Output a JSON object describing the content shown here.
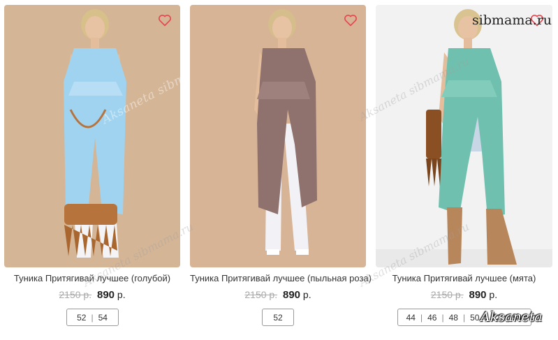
{
  "products": [
    {
      "title": "Туника Притягивай лучшее (голубой)",
      "old_price": "2150 р.",
      "new_price": "890",
      "currency": "р.",
      "sizes": [
        "52",
        "54"
      ],
      "bg_color": "#d4b596",
      "garment_color": "#9fd3ef"
    },
    {
      "title": "Туника Притягивай лучшее (пыльная роза)",
      "old_price": "2150 р.",
      "new_price": "890",
      "currency": "р.",
      "sizes": [
        "52"
      ],
      "bg_color": "#d8b497",
      "garment_color": "#8f726e"
    },
    {
      "title": "Туника Притягивай лучшее (мята)",
      "old_price": "2150 р.",
      "new_price": "890",
      "currency": "р.",
      "sizes": [
        "44",
        "46",
        "48",
        "50",
        "52",
        "54"
      ],
      "bg_color": "#f2f2f2",
      "garment_color": "#6fc0ae"
    }
  ],
  "watermarks": {
    "site": "sibmama.ru",
    "author": "Aksaneta sibmama.ru",
    "signature": "Aksaneta"
  },
  "icons": {
    "favorite": "heart-outline-icon"
  },
  "colors": {
    "heart": "#e4474f",
    "old_price": "#a9a9a9",
    "text": "#222222"
  }
}
